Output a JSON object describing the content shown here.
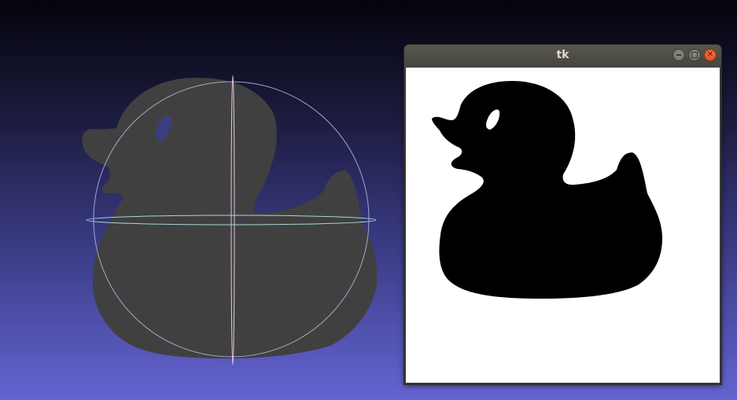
{
  "viewer": {
    "background_top": "#04040c",
    "background_bottom": "#6464d2",
    "mesh_color": "#404040",
    "trackball_color": "#c0c0e8"
  },
  "tk_window": {
    "title": "tk",
    "canvas_bg": "#ffffff",
    "silhouette_color": "#000000",
    "buttons": {
      "minimize": "minimize-icon",
      "maximize": "maximize-icon",
      "close": "close-icon",
      "close_glyph": "✕"
    }
  }
}
